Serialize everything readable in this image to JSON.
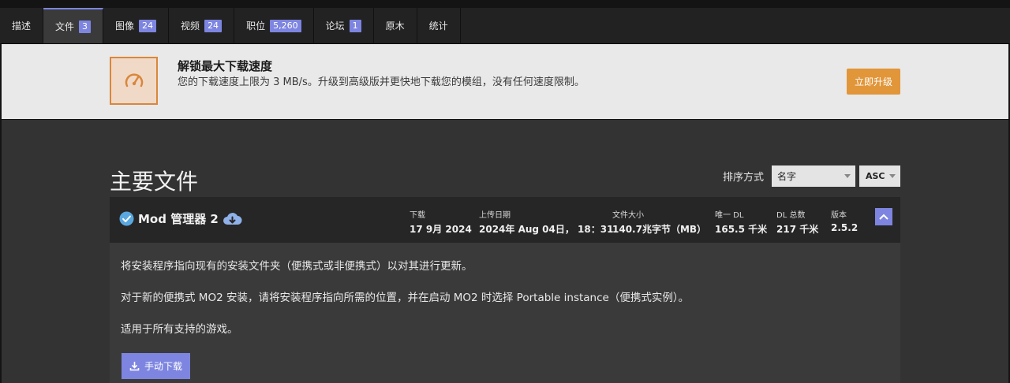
{
  "tabs": [
    {
      "label": "描述"
    },
    {
      "label": "文件",
      "count": "3"
    },
    {
      "label": "图像",
      "count": "24"
    },
    {
      "label": "视频",
      "count": "24"
    },
    {
      "label": "职位",
      "count": "5,260"
    },
    {
      "label": "论坛",
      "count": "1"
    },
    {
      "label": "原木"
    },
    {
      "label": "统计"
    }
  ],
  "promo": {
    "title": "解锁最大下载速度",
    "text": "您的下载速度上限为 3 MB/s。升级到高级版并更快地下载您的模组，没有任何速度限制。",
    "button": "立即升级",
    "icon": "speedometer-icon"
  },
  "main": {
    "section_title": "主要文件",
    "sort_label": "排序方式",
    "sort_value": "名字",
    "order_value": "ASC"
  },
  "file": {
    "title": "Mod 管理器 2",
    "meta": [
      {
        "label": "下载",
        "value": "17 9月 2024"
      },
      {
        "label": "上传日期",
        "value": "2024年 Aug 04日， 18：31"
      },
      {
        "label": "文件大小",
        "value": "140.7兆字节（MB）"
      },
      {
        "label": "唯一 DL",
        "value": "165.5 千米"
      },
      {
        "label": "DL 总数",
        "value": "217 千米"
      },
      {
        "label": "版本",
        "value": "2.5.2"
      }
    ],
    "paragraphs": [
      "将安装程序指向现有的安装文件夹（便携式或非便携式）以对其进行更新。",
      "对于新的便携式 MO2 安装，请将安装程序指向所需的位置，并在启动 MO2 时选择 Portable instance（便携式实例）。",
      "适用于所有支持的游戏。"
    ],
    "manual_button": "手动下载"
  },
  "colors": {
    "accent": "#7d85e0",
    "promo_orange": "#e1963a",
    "background": "#333333"
  }
}
